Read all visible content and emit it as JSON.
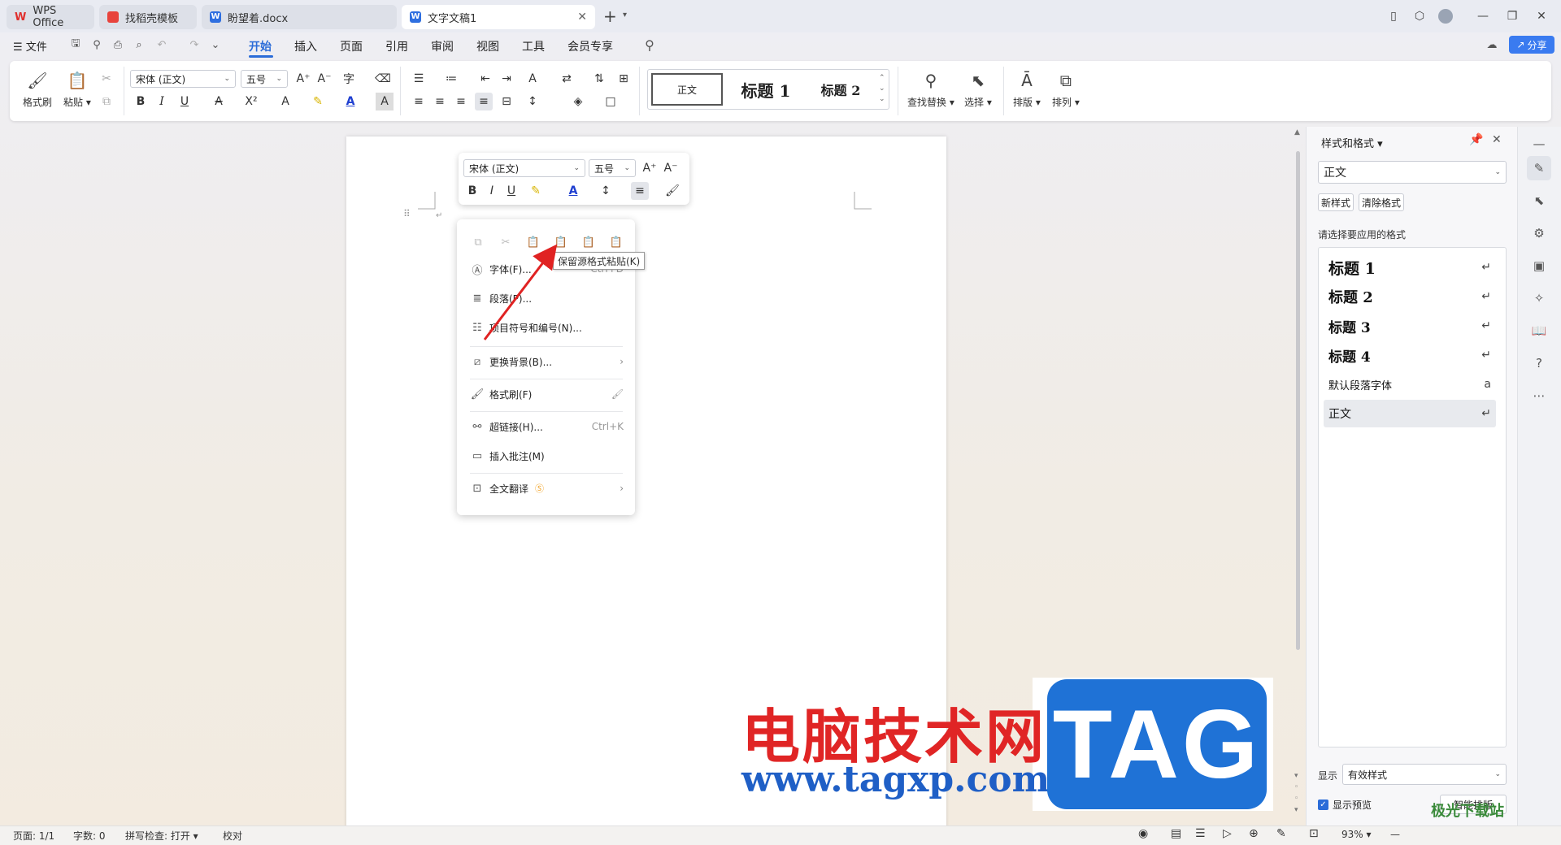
{
  "titlebar": {
    "tabs": [
      {
        "label": "WPS Office",
        "state": "inactive"
      },
      {
        "label": "找稻壳模板",
        "state": "inactive"
      },
      {
        "label": "盼望着.docx",
        "state": "inactive"
      },
      {
        "label": "文字文稿1",
        "state": "active"
      }
    ],
    "new_tab": "+"
  },
  "menubar": {
    "file": "文件",
    "items": [
      "开始",
      "插入",
      "页面",
      "引用",
      "审阅",
      "视图",
      "工具",
      "会员专享"
    ],
    "active": "开始",
    "share": "分享"
  },
  "ribbon": {
    "format_painter": "格式刷",
    "paste": "粘贴",
    "font_name": "宋体 (正文)",
    "font_size": "五号",
    "styles": [
      "正文",
      "标题 1",
      "标题 2"
    ],
    "find_replace": "查找替换",
    "select": "选择",
    "layout": "排版",
    "arrange": "排列"
  },
  "mini_toolbar": {
    "font_name": "宋体 (正文)",
    "font_size": "五号"
  },
  "context_menu": {
    "tooltip": "保留源格式粘贴(K)",
    "items": [
      {
        "label": "字体(F)...",
        "shortcut": "Ctrl+D"
      },
      {
        "label": "段落(P)...",
        "shortcut": ""
      },
      {
        "label": "项目符号和编号(N)...",
        "shortcut": ""
      },
      {
        "label": "更换背景(B)...",
        "shortcut": ""
      },
      {
        "label": "格式刷(F)",
        "shortcut": ""
      },
      {
        "label": "超链接(H)...",
        "shortcut": "Ctrl+K"
      },
      {
        "label": "插入批注(M)",
        "shortcut": ""
      },
      {
        "label": "全文翻译",
        "shortcut": ""
      }
    ]
  },
  "right_panel": {
    "title": "样式和格式",
    "current_style": "正文",
    "new_style": "新样式",
    "clear_format": "清除格式",
    "prompt": "请选择要应用的格式",
    "styles": [
      "标题 1",
      "标题 2",
      "标题 3",
      "标题 4",
      "默认段落字体",
      "正文"
    ],
    "show_label": "显示",
    "show_value": "有效样式",
    "preview_label": "显示预览",
    "smart_layout": "智能排版"
  },
  "statusbar": {
    "page": "页面: 1/1",
    "words": "字数: 0",
    "spell": "拼写检查: 打开",
    "proof": "校对",
    "zoom": "93%"
  },
  "watermark": {
    "cn": "电脑技术网",
    "url": "www.tagxp.com",
    "tag": "TAG",
    "site": "极光下载站"
  }
}
